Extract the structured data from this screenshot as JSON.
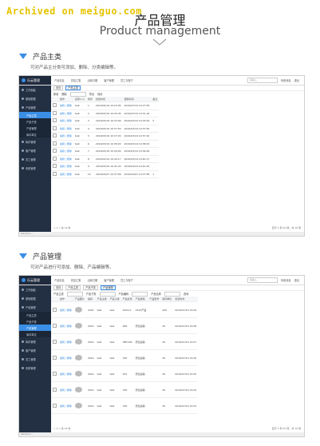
{
  "watermark": "Archived on meiguo.com",
  "header": {
    "title_cn": "产品管理",
    "title_en": "Product management"
  },
  "sections": [
    {
      "title": "产品主类",
      "desc": "可对产品主分类可添加、删除、分类编辑等。"
    },
    {
      "title": "产品管理",
      "desc": "可对产品进行可添加、删除、产品编辑等。"
    }
  ],
  "app": {
    "logo": "乐云管理",
    "nav": [
      "产品信息",
      "供应汇集",
      "出库日期",
      "客户管理",
      "员工与账户"
    ],
    "search_placeholder": "请输入",
    "right_links": [
      "系统消息",
      "退出"
    ],
    "sidebar": [
      "工作面板",
      "基础数据",
      "产品管理",
      "库存管理",
      "客户管理",
      "员工管理",
      "系统管理"
    ],
    "sidebar_sub": [
      "产品主类",
      "产品子类",
      "产品管理",
      "库存单位"
    ],
    "status_url": "192.0.0.1:...",
    "pager": "< 1 > 共 10 条",
    "pager_right": "显示 1 到 10 项，共 10 项"
  },
  "shot1": {
    "tabs": [
      "首页",
      "产品主类"
    ],
    "tools": [
      "新增",
      "删除",
      "导出",
      "保存"
    ],
    "columns": [
      "",
      "操作",
      "名称(cn)",
      "排序",
      "创建时间",
      "更新时间",
      "备注"
    ],
    "rows": [
      [
        "",
        "编辑 | 删除",
        "test",
        "1",
        "2019/04/19 10:23:05",
        "2019/07/19 10:27:56",
        ""
      ],
      [
        "",
        "编辑 | 删除",
        "test",
        "2",
        "2019/03/19 10:30:35",
        "2019/07/19 10:31:16",
        ""
      ],
      [
        "",
        "编辑 | 删除",
        "test",
        "3",
        "2019/03/19 10:33:09",
        "2019/03/19 10:33:09",
        "5"
      ],
      [
        "",
        "编辑 | 删除",
        "test",
        "4",
        "2019/03/19 10:37:50",
        "2019/03/19 10:37:50",
        ""
      ],
      [
        "",
        "编辑 | 删除",
        "test",
        "5",
        "2019/03/19 10:37:20",
        "2019/03/19 10:37:20",
        ""
      ],
      [
        "",
        "编辑 | 删除",
        "test",
        "6",
        "2019/03/19 10:38:03",
        "2019/03/19 10:38:03",
        ""
      ],
      [
        "",
        "编辑 | 删除",
        "test",
        "7",
        "2019/03/19 10:39:09",
        "2019/03/19 10:39:09",
        ""
      ],
      [
        "",
        "编辑 | 删除",
        "test",
        "8",
        "2019/03/19 10:40:17",
        "2019/03/19 10:40:17",
        ""
      ],
      [
        "",
        "编辑 | 删除",
        "test",
        "9",
        "2019/03/19 10:41:20",
        "2019/03/19 10:41:20",
        ""
      ],
      [
        "",
        "编辑 | 删除",
        "test",
        "10",
        "2019/03/07 10:37:58",
        "2019/03/07 10:37:58",
        "1"
      ]
    ]
  },
  "shot2": {
    "tabs": [
      "首页",
      "产品主类",
      "产品子类",
      "产品管理"
    ],
    "filter_labels": [
      "产品主类",
      "产品子类",
      "产品编码",
      "产品名称"
    ],
    "filter_button": "查询",
    "columns": [
      "",
      "操作",
      "产品图片",
      "编码",
      "产品主类",
      "产品子类",
      "产品名称",
      "产品规格",
      "产品型号",
      "库存单位",
      "创建时间"
    ],
    "rows": [
      [
        "",
        "编辑 | 删除",
        "",
        "2222",
        "test",
        "test",
        "2222-0",
        "2222产品",
        "",
        "200",
        "2019/07/19 10:29"
      ],
      [
        "",
        "编辑 | 删除",
        "",
        "2019",
        "test",
        "test",
        "006",
        "原位运输",
        "",
        "20",
        "2019/07/19 10:28"
      ],
      [
        "",
        "编辑 | 删除",
        "",
        "2019",
        "test",
        "test",
        "HB7209",
        "原位运输",
        "",
        "20",
        "2019/07/19 10:27"
      ],
      [
        "",
        "编辑 | 删除",
        "",
        "2019",
        "test",
        "test",
        "700",
        "原位运输",
        "",
        "20",
        "2019/07/19 10:26"
      ],
      [
        "",
        "编辑 | 删除",
        "",
        "2019",
        "test",
        "test",
        "301",
        "原位运输",
        "",
        "20",
        "2019/07/19 10:25"
      ],
      [
        "",
        "编辑 | 删除",
        "",
        "2019",
        "test",
        "test",
        "700",
        "原位运输",
        "",
        "20",
        "2019/07/19 10:24"
      ],
      [
        "",
        "编辑 | 删除",
        "",
        "2019",
        "test",
        "test",
        "700",
        "原位运输",
        "",
        "20",
        "2019/07/19 10:23"
      ]
    ]
  }
}
